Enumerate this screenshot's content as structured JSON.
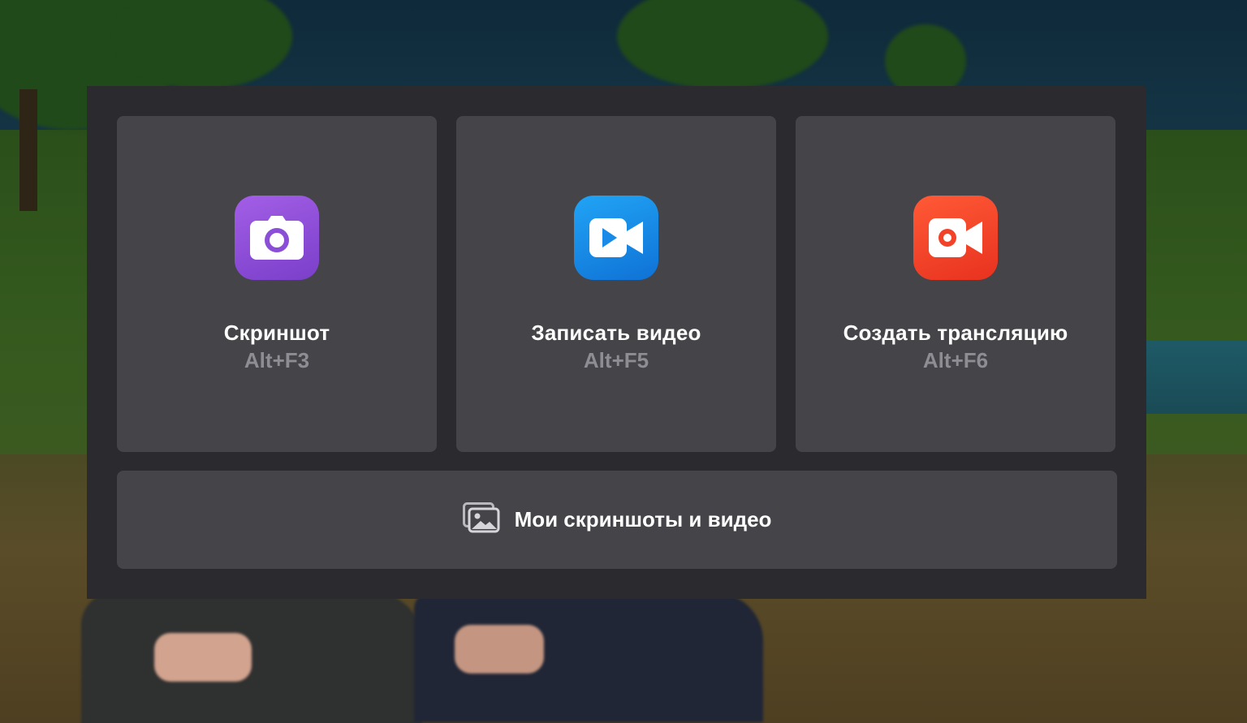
{
  "menu": {
    "tiles": [
      {
        "title": "Скриншот",
        "shortcut": "Alt+F3",
        "icon": "camera-icon",
        "color": "#8a4fd6"
      },
      {
        "title": "Записать видео",
        "shortcut": "Alt+F5",
        "icon": "video-camera-icon",
        "color": "#1a8ae8"
      },
      {
        "title": "Создать трансляцию",
        "shortcut": "Alt+F6",
        "icon": "broadcast-camera-icon",
        "color": "#f2432a"
      }
    ],
    "gallery": {
      "label": "Мои скриншоты и видео",
      "icon": "gallery-icon"
    }
  },
  "colors": {
    "panel_bg": "#2b2a2f",
    "tile_bg": "#454449",
    "shortcut_text": "#8e8d93"
  }
}
